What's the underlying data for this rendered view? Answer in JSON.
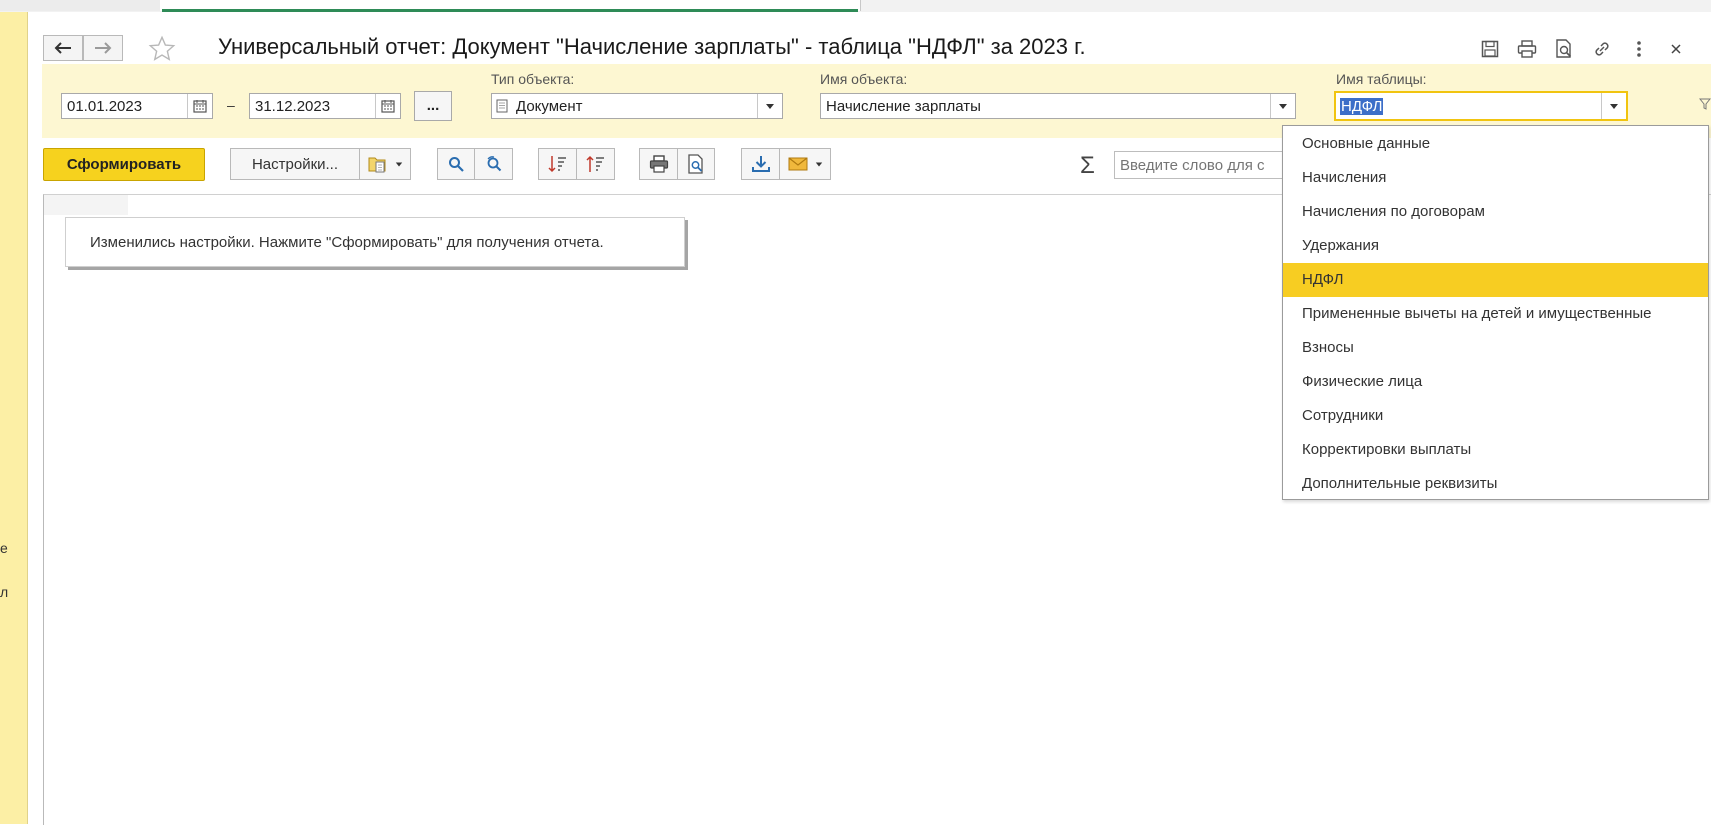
{
  "title": "Универсальный отчет: Документ \"Начисление зарплаты\" - таблица \"НДФЛ\" за 2023 г.",
  "period": {
    "from": "01.01.2023",
    "dash": "–",
    "to": "31.12.2023",
    "more_label": "..."
  },
  "object_type": {
    "label": "Тип объекта:",
    "value": "Документ"
  },
  "object_name": {
    "label": "Имя объекта:",
    "value": "Начисление зарплаты"
  },
  "table_name": {
    "label": "Имя таблицы:",
    "value": "НДФЛ"
  },
  "toolbar": {
    "generate_label": "Сформировать",
    "settings_label": "Настройки...",
    "sigma": "Σ",
    "search_placeholder": "Введите слово для с"
  },
  "notice": "Изменились настройки. Нажмите \"Сформировать\" для получения отчета.",
  "dropdown_items": [
    "Основные данные",
    "Начисления",
    "Начисления по договорам",
    "Удержания",
    "НДФЛ",
    "Примененные вычеты на детей и имущественные",
    "Взносы",
    "Физические лица",
    "Сотрудники",
    "Корректировки выплаты",
    "Дополнительные реквизиты"
  ],
  "selected_item": "НДФЛ",
  "left_panel_fragments": [
    "е",
    "л"
  ],
  "colors": {
    "accent_yellow": "#f6d21e",
    "panel_yellow": "#fdf7d2",
    "selection": "#f7cd22"
  }
}
